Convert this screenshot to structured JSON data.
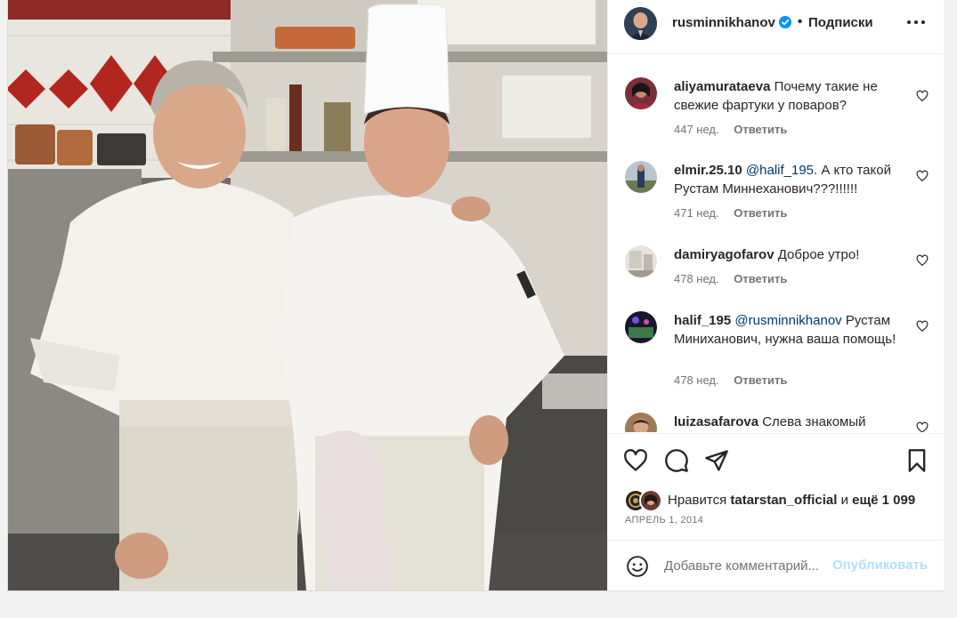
{
  "post": {
    "author": "rusminnikhanov",
    "follow_label": "Подписки",
    "separator": "•",
    "verified": true,
    "more_icon": "more-horizontal-icon"
  },
  "comments": [
    {
      "user": "aliyamurataeva",
      "mention": "",
      "text": "Почему такие не свежие фартуки у поваров?",
      "age": "447 нед.",
      "reply": "Ответить"
    },
    {
      "user": "elmir.25.10",
      "mention": "@halif_195",
      "text": ". А кто такой Рустам Миннеханович???!!!!!!",
      "age": "471 нед.",
      "reply": "Ответить"
    },
    {
      "user": "damiryagofarov",
      "mention": "",
      "text": "Доброе утро!",
      "age": "478 нед.",
      "reply": "Ответить"
    },
    {
      "user": "halif_195",
      "mention": "@rusminnikhanov",
      "text": " Рустам Миниханович, нужна ваша помощь!",
      "age": "478 нед.",
      "reply": "Ответить"
    },
    {
      "user": "luizasafarova",
      "mention": "",
      "text": "Слева знакомый",
      "age": "",
      "reply": ""
    }
  ],
  "actions": {
    "like_icon": "heart-icon",
    "comment_icon": "comment-bubble-icon",
    "share_icon": "paper-plane-icon",
    "save_icon": "bookmark-icon"
  },
  "likes": {
    "prefix": "Нравится ",
    "user": "tatarstan_official",
    "middle": " и ",
    "count": "ещё 1 099"
  },
  "date": "АПРЕЛЬ 1, 2014",
  "add_comment": {
    "placeholder": "Добавьте комментарий...",
    "publish_label": "Опубликовать",
    "emoji_icon": "smiley-icon"
  },
  "colors": {
    "verified": "#0095f6",
    "publish_disabled": "#b2dffc",
    "text_primary": "#262626",
    "text_secondary": "#737373",
    "mention": "#00376b"
  }
}
